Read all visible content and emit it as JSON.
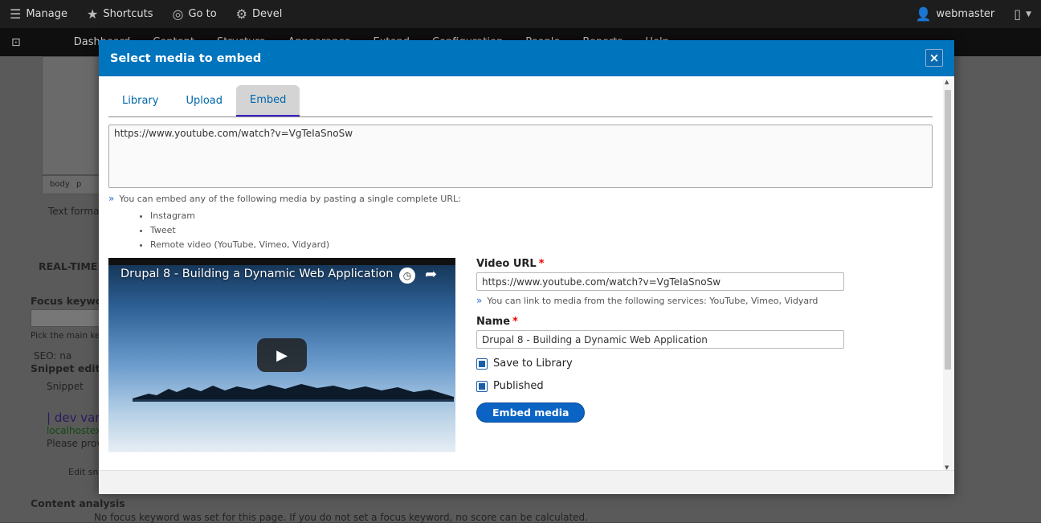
{
  "toolbar": {
    "manage": "Manage",
    "shortcuts": "Shortcuts",
    "goto": "Go to",
    "devel": "Devel",
    "user": "webmaster"
  },
  "tray": {
    "items": [
      "Dashboard",
      "Content",
      "Structure",
      "Appearance",
      "Extend",
      "Configuration",
      "People",
      "Reports",
      "Help"
    ]
  },
  "background": {
    "path_body": "body",
    "path_p": "p",
    "text_format": "Text format",
    "realtime": "REAL-TIME SEO",
    "focus_keyword": "Focus keyword",
    "pick_main": "Pick the main keyword",
    "seo": "SEO: na",
    "snippet_editor": "Snippet editor",
    "snippet": "Snippet",
    "dev_var": "| dev var",
    "localhost": "localhostex",
    "please_provide": "Please provi",
    "edit_snippet": "Edit sn",
    "content_analysis": "Content analysis",
    "no_focus": "No focus keyword was set for this page. If you do not set a focus keyword, no score can be calculated."
  },
  "dialog": {
    "title": "Select media to embed",
    "tabs": [
      {
        "label": "Library"
      },
      {
        "label": "Upload"
      },
      {
        "label": "Embed",
        "active": true
      }
    ],
    "url_value": "https://www.youtube.com/watch?v=VgTeIaSnoSw",
    "embed_help": "You can embed any of the following media by pasting a single complete URL:",
    "media_types": [
      "Instagram",
      "Tweet",
      "Remote video (YouTube, Vimeo, Vidyard)"
    ],
    "video": {
      "title": "Drupal 8 - Building a Dynamic Web Application"
    },
    "video_url": {
      "label": "Video URL",
      "required": "*",
      "value": "https://www.youtube.com/watch?v=VgTeIaSnoSw",
      "help": "You can link to media from the following services: YouTube, Vimeo, Vidyard"
    },
    "name": {
      "label": "Name",
      "required": "*",
      "value": "Drupal 8 - Building a Dynamic Web Application"
    },
    "save_to_library": {
      "label": "Save to Library",
      "checked": true
    },
    "published": {
      "label": "Published",
      "checked": true
    },
    "embed_button": "Embed media",
    "close_symbol": "×"
  },
  "colors": {
    "title_bar": "#0074bd",
    "link": "#0066aa",
    "button": "#0b63c4",
    "required": "#ee0000"
  }
}
